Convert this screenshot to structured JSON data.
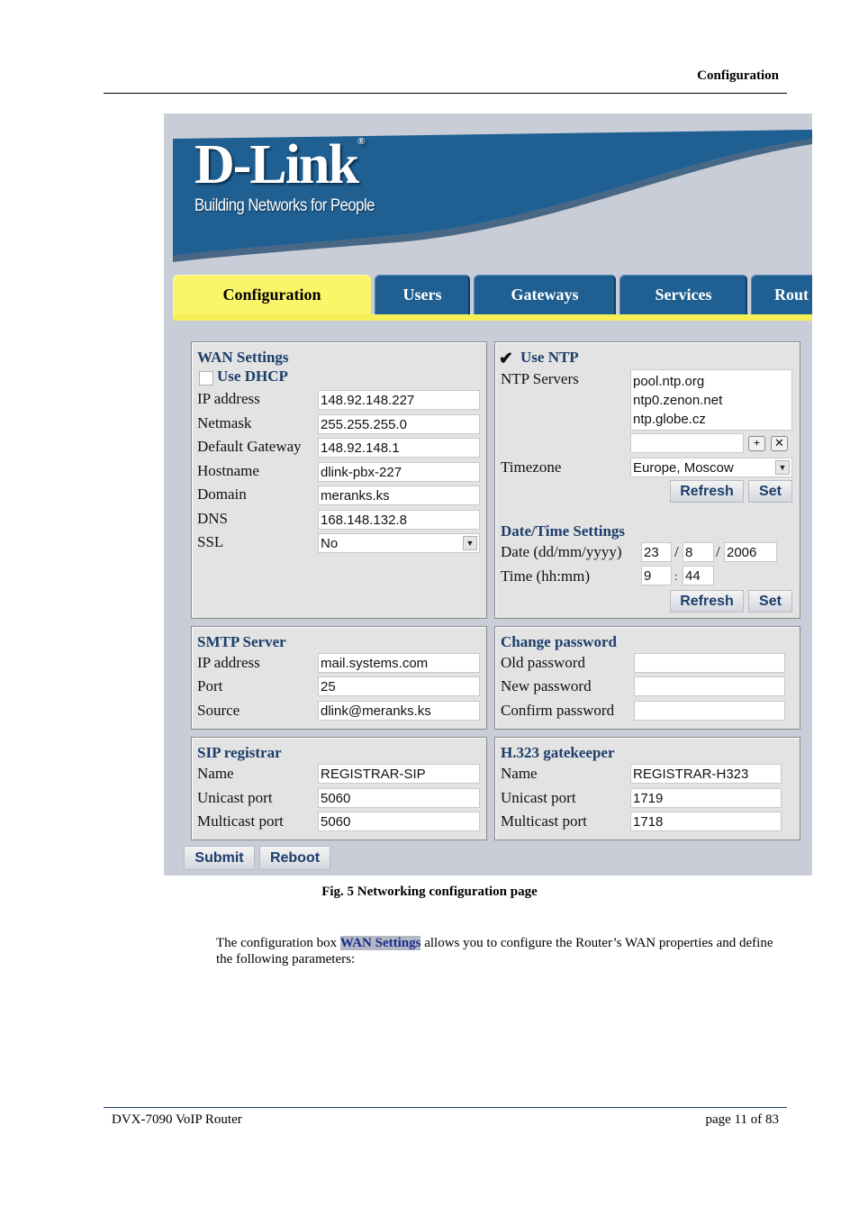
{
  "document": {
    "header_title": "Configuration",
    "caption": "Fig. 5 Networking configuration page",
    "paragraph": {
      "before": "The configuration box ",
      "highlight": "WAN Settings",
      "after": " allows you to configure the Router’s WAN properties and define the following parameters:"
    },
    "footer_left": "DVX-7090 VoIP Router",
    "footer_right": "page 11 of 83"
  },
  "colors": {
    "banner_blue": "#1f5f91",
    "active_tab": "#fbf56a",
    "panel_title": "#1c3e6b",
    "background": "#c8cdd8"
  },
  "screenshot": {
    "logo": "D-Link",
    "logo_mark": "®",
    "tagline": "Building Networks for People",
    "tabs": [
      {
        "label": "Configuration",
        "active": true
      },
      {
        "label": "Users",
        "active": false
      },
      {
        "label": "Gateways",
        "active": false
      },
      {
        "label": "Services",
        "active": false
      },
      {
        "label": "Rout",
        "active": false
      }
    ],
    "wan": {
      "title": "WAN Settings",
      "use_dhcp_label": "Use DHCP",
      "use_dhcp_checked": false,
      "fields": [
        {
          "label": "IP address",
          "value": "148.92.148.227"
        },
        {
          "label": "Netmask",
          "value": "255.255.255.0"
        },
        {
          "label": "Default Gateway",
          "value": "148.92.148.1"
        },
        {
          "label": "Hostname",
          "value": "dlink-pbx-227"
        },
        {
          "label": "Domain",
          "value": "meranks.ks"
        },
        {
          "label": "DNS",
          "value": "168.148.132.8"
        }
      ],
      "ssl_label": "SSL",
      "ssl_value": "No"
    },
    "ntp": {
      "use_ntp_label": "Use NTP",
      "use_ntp_checked": true,
      "servers_label": "NTP Servers",
      "servers": [
        "pool.ntp.org",
        "ntp0.zenon.net",
        "ntp.globe.cz"
      ],
      "new_server_value": "",
      "add_icon": "plus-icon",
      "remove_icon": "x-icon",
      "timezone_label": "Timezone",
      "timezone_value": "Europe, Moscow",
      "refresh_label": "Refresh",
      "set_label": "Set"
    },
    "datetime": {
      "title": "Date/Time Settings",
      "date_label": "Date (dd/mm/yyyy)",
      "day": "23",
      "month": "8",
      "year": "2006",
      "date_sep": "/",
      "time_label": "Time (hh:mm)",
      "hour": "9",
      "minute": "44",
      "time_sep": ":",
      "refresh_label": "Refresh",
      "set_label": "Set"
    },
    "smtp": {
      "title": "SMTP Server",
      "fields": [
        {
          "label": "IP address",
          "value": "mail.systems.com"
        },
        {
          "label": "Port",
          "value": "25"
        },
        {
          "label": "Source",
          "value": "dlink@meranks.ks"
        }
      ]
    },
    "password": {
      "title": "Change password",
      "fields": [
        {
          "label": "Old password",
          "value": ""
        },
        {
          "label": "New password",
          "value": ""
        },
        {
          "label": "Confirm password",
          "value": ""
        }
      ]
    },
    "sip": {
      "title": "SIP registrar",
      "fields": [
        {
          "label": "Name",
          "value": "REGISTRAR-SIP"
        },
        {
          "label": "Unicast port",
          "value": "5060"
        },
        {
          "label": "Multicast port",
          "value": "5060"
        }
      ]
    },
    "h323": {
      "title": "H.323 gatekeeper",
      "fields": [
        {
          "label": "Name",
          "value": "REGISTRAR-H323"
        },
        {
          "label": "Unicast port",
          "value": "1719"
        },
        {
          "label": "Multicast port",
          "value": "1718"
        }
      ]
    },
    "submit_label": "Submit",
    "reboot_label": "Reboot"
  }
}
